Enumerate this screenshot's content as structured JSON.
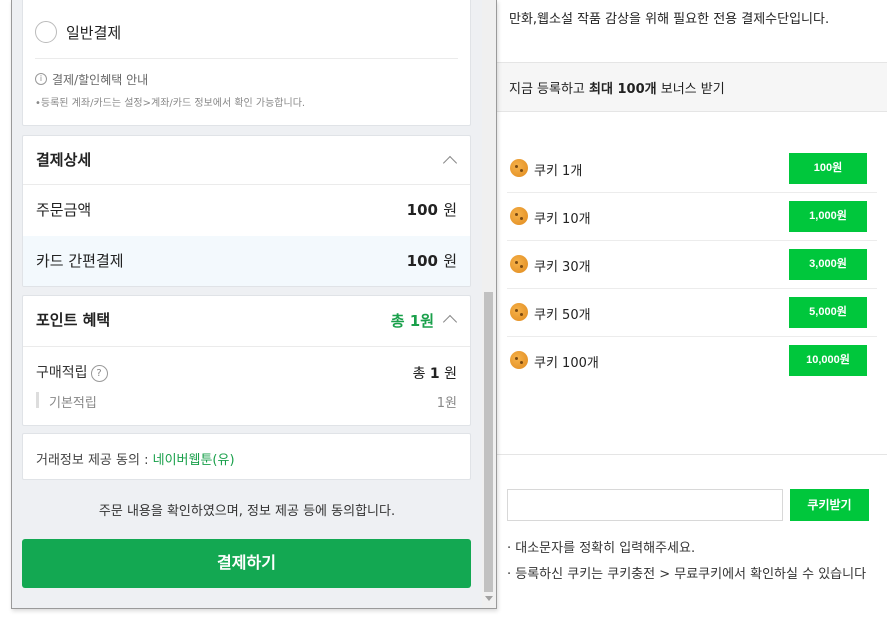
{
  "background_page": {
    "intro": "만화,웹소설 작품 감상을 위해 필요한 전용 결제수단입니다.",
    "bonus_prefix": "지금 등록하고",
    "bonus_bold": "최대 100개",
    "bonus_suffix": "보너스 받기",
    "cookies": [
      {
        "label": "쿠키 1개",
        "price": "100원"
      },
      {
        "label": "쿠키 10개",
        "price": "1,000원"
      },
      {
        "label": "쿠키 30개",
        "price": "3,000원"
      },
      {
        "label": "쿠키 50개",
        "price": "5,000원"
      },
      {
        "label": "쿠키 100개",
        "price": "10,000원"
      }
    ],
    "coupon_input_value": "",
    "coupon_button": "쿠키받기",
    "notes": [
      "· 대소문자를 정확히 입력해주세요.",
      "· 등록하신 쿠키는 쿠키충전 > 무료쿠키에서 확인하실 수 있습니다"
    ]
  },
  "popup": {
    "payment_method": {
      "radio_label": "일반결제",
      "info_icon_glyph": "i",
      "info_title": "결제/할인혜택 안내",
      "info_desc": "•등록된 계좌/카드는 설정>계좌/카드 정보에서 확인 가능합니다."
    },
    "detail": {
      "title": "결제상세",
      "order_label": "주문금액",
      "order_value": "100",
      "order_unit": "원",
      "card_label": "카드 간편결제",
      "card_value": "100",
      "card_unit": "원"
    },
    "points": {
      "title": "포인트 혜택",
      "total": "총 1원",
      "purchase_label": "구매적립",
      "help_glyph": "?",
      "purchase_prefix": "총",
      "purchase_value": "1",
      "purchase_unit": "원",
      "basic_label": "기본적립",
      "basic_value": "1원"
    },
    "agreement": {
      "label": "거래정보 제공 동의 :",
      "link": "네이버웹툰(유)"
    },
    "confirm_text": "주문 내용을 확인하였으며, 정보 제공 등에 동의합니다.",
    "pay_button": "결제하기"
  },
  "colors": {
    "accent_green": "#00c73c",
    "pay_button_green": "#13a852",
    "point_green": "#1aa04b"
  }
}
